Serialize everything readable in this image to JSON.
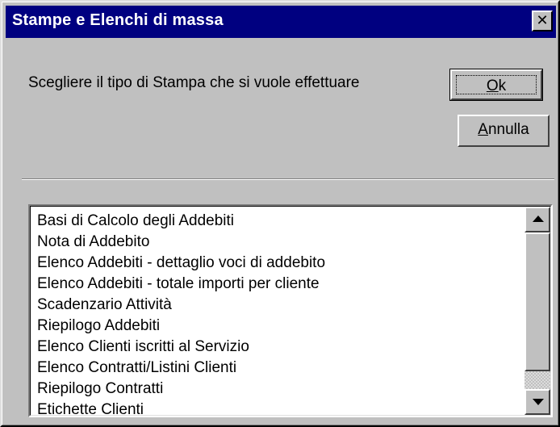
{
  "window": {
    "title": "Stampe e Elenchi di massa",
    "close_label": "✕"
  },
  "prompt": "Scegliere il tipo di Stampa che si vuole effettuare",
  "buttons": {
    "ok": {
      "mnemonic": "O",
      "rest": "k"
    },
    "cancel": {
      "mnemonic": "A",
      "rest": "nnulla"
    }
  },
  "list": {
    "items": [
      "Basi di Calcolo degli Addebiti",
      "Nota di Addebito",
      "Elenco Addebiti - dettaglio voci di addebito",
      "Elenco Addebiti - totale importi per cliente",
      "Scadenzario Attività",
      "Riepilogo Addebiti",
      "Elenco Clienti iscritti al Servizio",
      "Elenco Contratti/Listini Clienti",
      "Riepilogo Contratti",
      "Etichette Clienti"
    ]
  },
  "colors": {
    "titlebar": "#000080",
    "face": "#c0c0c0",
    "list_background": "#ffffff"
  },
  "icons": {
    "close": "close-icon",
    "scroll_up": "arrow-up-icon",
    "scroll_down": "arrow-down-icon"
  }
}
